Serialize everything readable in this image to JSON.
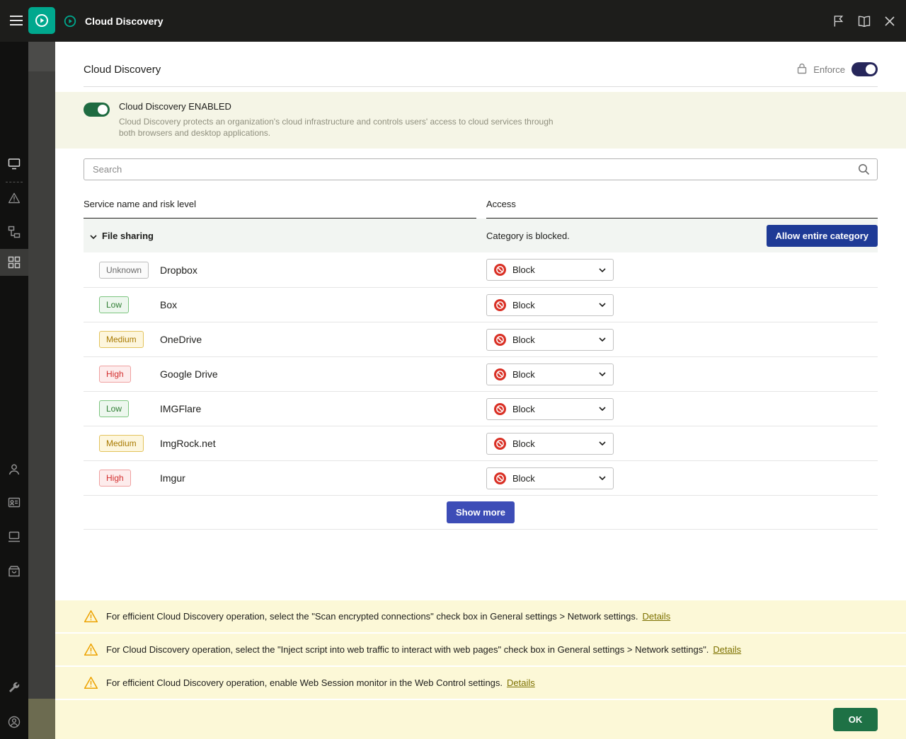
{
  "topbar": {
    "title": "Cloud Discovery"
  },
  "page": {
    "title": "Cloud Discovery",
    "enforce_label": "Enforce"
  },
  "banner": {
    "title": "Cloud Discovery ENABLED",
    "description": "Cloud Discovery protects an organization's cloud infrastructure and controls users' access to cloud services through both browsers and desktop applications."
  },
  "search": {
    "placeholder": "Search"
  },
  "table": {
    "columns": {
      "c1": "Service name and risk level",
      "c2": "Access"
    },
    "category": {
      "name": "File sharing",
      "status": "Category is blocked.",
      "action_label": "Allow entire category"
    },
    "rows": [
      {
        "risk": "Unknown",
        "service": "Dropbox",
        "access": "Block"
      },
      {
        "risk": "Low",
        "service": "Box",
        "access": "Block"
      },
      {
        "risk": "Medium",
        "service": "OneDrive",
        "access": "Block"
      },
      {
        "risk": "High",
        "service": "Google Drive",
        "access": "Block"
      },
      {
        "risk": "Low",
        "service": "IMGFlare",
        "access": "Block"
      },
      {
        "risk": "Medium",
        "service": "ImgRock.net",
        "access": "Block"
      },
      {
        "risk": "High",
        "service": "Imgur",
        "access": "Block"
      }
    ],
    "show_more_label": "Show more"
  },
  "warnings": [
    {
      "text": "For efficient Cloud Discovery operation, select the \"Scan encrypted connections\" check box in General settings > Network settings.",
      "link": "Details"
    },
    {
      "text": "For Cloud Discovery operation, select the \"Inject script into web traffic to interact with web pages\" check box in General settings > Network settings\".",
      "link": "Details"
    },
    {
      "text": "For efficient Cloud Discovery operation, enable Web Session monitor in the Web Control settings.",
      "link": "Details"
    }
  ],
  "footer": {
    "ok_label": "OK"
  },
  "colors": {
    "accent_teal": "#00a88e",
    "blocked_red": "#d93025",
    "category_button_navy": "#1e3a96",
    "show_more_blue": "#3d4db7",
    "ok_green": "#1e7145",
    "warning_bg": "#fcf8d7",
    "banner_bg": "#f5f5e6"
  }
}
